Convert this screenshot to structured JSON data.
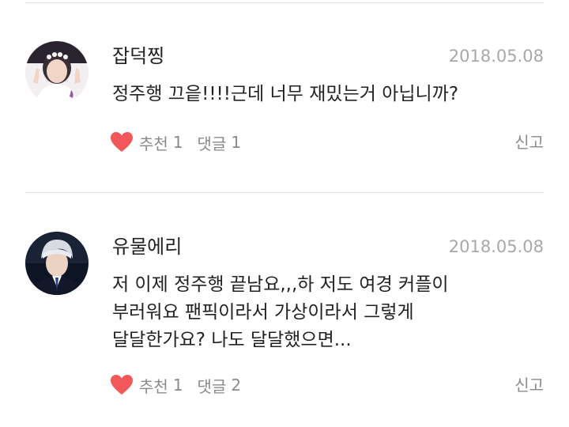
{
  "comments": [
    {
      "author": "잡덕찡",
      "date": "2018.05.08",
      "body_lines": [
        "정주행 끄읕!!!!근데 너무 재밌는거 아닙니까?"
      ],
      "like_label": "추천",
      "like_count": "1",
      "reply_label": "댓글",
      "reply_count": "1",
      "report_label": "신고",
      "avatar_icon": "profile-photo"
    },
    {
      "author": "유물에리",
      "date": "2018.05.08",
      "body_lines": [
        "저 이제 정주행 끝남요,,,하 저도 여경 커플이",
        "부러워요 팬픽이라서 가상이라서 그렇게",
        "달달한가요? 나도 달달했으면..."
      ],
      "like_label": "추천",
      "like_count": "1",
      "reply_label": "댓글",
      "reply_count": "2",
      "report_label": "신고",
      "avatar_icon": "profile-photo"
    }
  ],
  "colors": {
    "heart": "#f2585a",
    "meta_text": "#8a8a8a",
    "date_text": "#a8a8a8",
    "divider": "#e6e6e6"
  }
}
